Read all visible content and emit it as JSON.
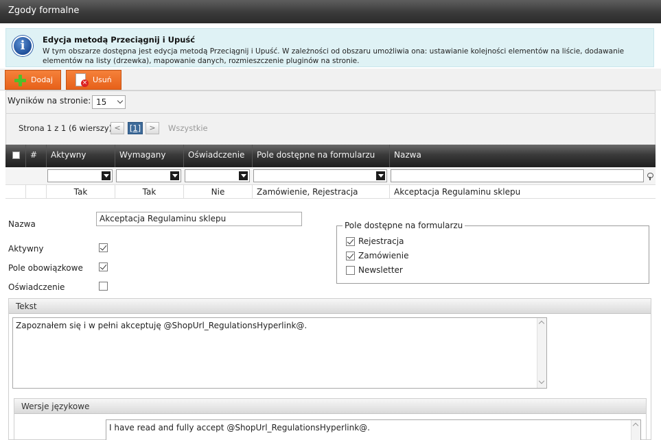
{
  "window": {
    "title": "Zgody formalne"
  },
  "info": {
    "heading": "Edycja metodą Przeciągnij i Upuść",
    "text": "W tym obszarze dostępna jest edycja metodą Przeciągnij i Upuść. W zależności od obszaru umożliwia ona: ustawianie kolejności elementów na liście, dodawanie elementów na listy (drzewka), mapowanie danych, rozmieszczenie pluginów na stronie."
  },
  "toolbar": {
    "add_label": "Dodaj",
    "delete_label": "Usuń"
  },
  "grid": {
    "per_page_label": "Wyników na stronie:",
    "per_page_value": "15",
    "pager_text": "Strona 1 z 1 (6 wierszy)",
    "prev": "<",
    "current_page": "[1]",
    "next": ">",
    "all_label": "Wszystkie",
    "columns": [
      "#",
      "Aktywny",
      "Wymagany",
      "Oświadczenie",
      "Pole dostępne na formularzu",
      "Nazwa"
    ],
    "row": {
      "aktywny": "Tak",
      "wymagany": "Tak",
      "oswiadczenie": "Nie",
      "pole": "Zamówienie, Rejestracja",
      "nazwa": "Akceptacja Regulaminu sklepu"
    }
  },
  "form": {
    "name_label": "Nazwa",
    "name_value": "Akceptacja Regulaminu sklepu",
    "active_label": "Aktywny",
    "required_label": "Pole obowiązkowe",
    "statement_label": "Oświadczenie",
    "active": true,
    "required": true,
    "statement": false,
    "fields_legend": "Pole dostępne na formularzu",
    "fields": [
      {
        "label": "Rejestracja",
        "checked": true
      },
      {
        "label": "Zamówienie",
        "checked": true
      },
      {
        "label": "Newsletter",
        "checked": false
      }
    ]
  },
  "text_panel": {
    "title": "Tekst",
    "value": "Zapoznałem się i w pełni akceptuję @ShopUrl_RegulationsHyperlink@."
  },
  "lang_panel": {
    "title": "Wersje językowe",
    "value": "I have read and fully accept @ShopUrl_RegulationsHyperlink@."
  }
}
